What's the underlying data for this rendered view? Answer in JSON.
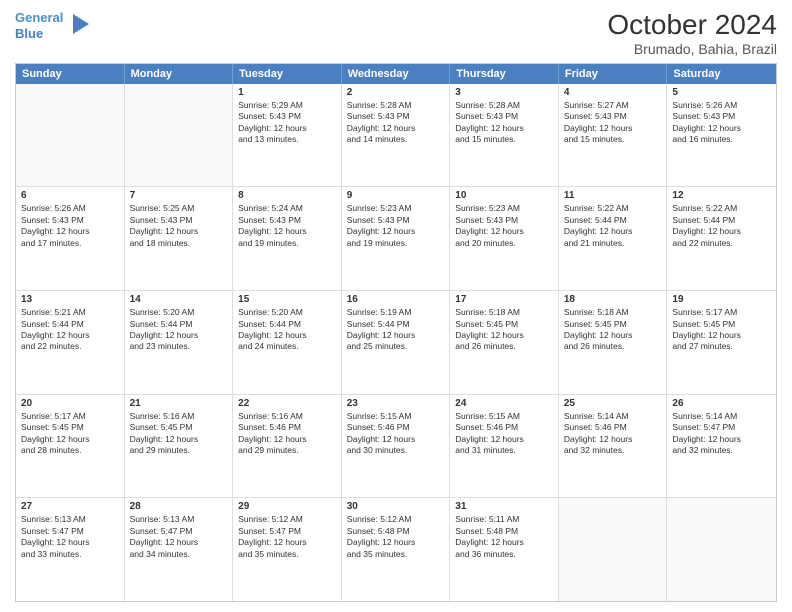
{
  "logo": {
    "line1": "General",
    "line2": "Blue",
    "icon": "▶"
  },
  "title": "October 2024",
  "subtitle": "Brumado, Bahia, Brazil",
  "header_days": [
    "Sunday",
    "Monday",
    "Tuesday",
    "Wednesday",
    "Thursday",
    "Friday",
    "Saturday"
  ],
  "weeks": [
    [
      {
        "day": "",
        "sunrise": "",
        "sunset": "",
        "daylight": "",
        "empty": true
      },
      {
        "day": "",
        "sunrise": "",
        "sunset": "",
        "daylight": "",
        "empty": true
      },
      {
        "day": "1",
        "sunrise": "Sunrise: 5:29 AM",
        "sunset": "Sunset: 5:43 PM",
        "daylight": "Daylight: 12 hours and 13 minutes.",
        "empty": false
      },
      {
        "day": "2",
        "sunrise": "Sunrise: 5:28 AM",
        "sunset": "Sunset: 5:43 PM",
        "daylight": "Daylight: 12 hours and 14 minutes.",
        "empty": false
      },
      {
        "day": "3",
        "sunrise": "Sunrise: 5:28 AM",
        "sunset": "Sunset: 5:43 PM",
        "daylight": "Daylight: 12 hours and 15 minutes.",
        "empty": false
      },
      {
        "day": "4",
        "sunrise": "Sunrise: 5:27 AM",
        "sunset": "Sunset: 5:43 PM",
        "daylight": "Daylight: 12 hours and 15 minutes.",
        "empty": false
      },
      {
        "day": "5",
        "sunrise": "Sunrise: 5:26 AM",
        "sunset": "Sunset: 5:43 PM",
        "daylight": "Daylight: 12 hours and 16 minutes.",
        "empty": false
      }
    ],
    [
      {
        "day": "6",
        "sunrise": "Sunrise: 5:26 AM",
        "sunset": "Sunset: 5:43 PM",
        "daylight": "Daylight: 12 hours and 17 minutes.",
        "empty": false
      },
      {
        "day": "7",
        "sunrise": "Sunrise: 5:25 AM",
        "sunset": "Sunset: 5:43 PM",
        "daylight": "Daylight: 12 hours and 18 minutes.",
        "empty": false
      },
      {
        "day": "8",
        "sunrise": "Sunrise: 5:24 AM",
        "sunset": "Sunset: 5:43 PM",
        "daylight": "Daylight: 12 hours and 19 minutes.",
        "empty": false
      },
      {
        "day": "9",
        "sunrise": "Sunrise: 5:23 AM",
        "sunset": "Sunset: 5:43 PM",
        "daylight": "Daylight: 12 hours and 19 minutes.",
        "empty": false
      },
      {
        "day": "10",
        "sunrise": "Sunrise: 5:23 AM",
        "sunset": "Sunset: 5:43 PM",
        "daylight": "Daylight: 12 hours and 20 minutes.",
        "empty": false
      },
      {
        "day": "11",
        "sunrise": "Sunrise: 5:22 AM",
        "sunset": "Sunset: 5:44 PM",
        "daylight": "Daylight: 12 hours and 21 minutes.",
        "empty": false
      },
      {
        "day": "12",
        "sunrise": "Sunrise: 5:22 AM",
        "sunset": "Sunset: 5:44 PM",
        "daylight": "Daylight: 12 hours and 22 minutes.",
        "empty": false
      }
    ],
    [
      {
        "day": "13",
        "sunrise": "Sunrise: 5:21 AM",
        "sunset": "Sunset: 5:44 PM",
        "daylight": "Daylight: 12 hours and 22 minutes.",
        "empty": false
      },
      {
        "day": "14",
        "sunrise": "Sunrise: 5:20 AM",
        "sunset": "Sunset: 5:44 PM",
        "daylight": "Daylight: 12 hours and 23 minutes.",
        "empty": false
      },
      {
        "day": "15",
        "sunrise": "Sunrise: 5:20 AM",
        "sunset": "Sunset: 5:44 PM",
        "daylight": "Daylight: 12 hours and 24 minutes.",
        "empty": false
      },
      {
        "day": "16",
        "sunrise": "Sunrise: 5:19 AM",
        "sunset": "Sunset: 5:44 PM",
        "daylight": "Daylight: 12 hours and 25 minutes.",
        "empty": false
      },
      {
        "day": "17",
        "sunrise": "Sunrise: 5:18 AM",
        "sunset": "Sunset: 5:45 PM",
        "daylight": "Daylight: 12 hours and 26 minutes.",
        "empty": false
      },
      {
        "day": "18",
        "sunrise": "Sunrise: 5:18 AM",
        "sunset": "Sunset: 5:45 PM",
        "daylight": "Daylight: 12 hours and 26 minutes.",
        "empty": false
      },
      {
        "day": "19",
        "sunrise": "Sunrise: 5:17 AM",
        "sunset": "Sunset: 5:45 PM",
        "daylight": "Daylight: 12 hours and 27 minutes.",
        "empty": false
      }
    ],
    [
      {
        "day": "20",
        "sunrise": "Sunrise: 5:17 AM",
        "sunset": "Sunset: 5:45 PM",
        "daylight": "Daylight: 12 hours and 28 minutes.",
        "empty": false
      },
      {
        "day": "21",
        "sunrise": "Sunrise: 5:16 AM",
        "sunset": "Sunset: 5:45 PM",
        "daylight": "Daylight: 12 hours and 29 minutes.",
        "empty": false
      },
      {
        "day": "22",
        "sunrise": "Sunrise: 5:16 AM",
        "sunset": "Sunset: 5:46 PM",
        "daylight": "Daylight: 12 hours and 29 minutes.",
        "empty": false
      },
      {
        "day": "23",
        "sunrise": "Sunrise: 5:15 AM",
        "sunset": "Sunset: 5:46 PM",
        "daylight": "Daylight: 12 hours and 30 minutes.",
        "empty": false
      },
      {
        "day": "24",
        "sunrise": "Sunrise: 5:15 AM",
        "sunset": "Sunset: 5:46 PM",
        "daylight": "Daylight: 12 hours and 31 minutes.",
        "empty": false
      },
      {
        "day": "25",
        "sunrise": "Sunrise: 5:14 AM",
        "sunset": "Sunset: 5:46 PM",
        "daylight": "Daylight: 12 hours and 32 minutes.",
        "empty": false
      },
      {
        "day": "26",
        "sunrise": "Sunrise: 5:14 AM",
        "sunset": "Sunset: 5:47 PM",
        "daylight": "Daylight: 12 hours and 32 minutes.",
        "empty": false
      }
    ],
    [
      {
        "day": "27",
        "sunrise": "Sunrise: 5:13 AM",
        "sunset": "Sunset: 5:47 PM",
        "daylight": "Daylight: 12 hours and 33 minutes.",
        "empty": false
      },
      {
        "day": "28",
        "sunrise": "Sunrise: 5:13 AM",
        "sunset": "Sunset: 5:47 PM",
        "daylight": "Daylight: 12 hours and 34 minutes.",
        "empty": false
      },
      {
        "day": "29",
        "sunrise": "Sunrise: 5:12 AM",
        "sunset": "Sunset: 5:47 PM",
        "daylight": "Daylight: 12 hours and 35 minutes.",
        "empty": false
      },
      {
        "day": "30",
        "sunrise": "Sunrise: 5:12 AM",
        "sunset": "Sunset: 5:48 PM",
        "daylight": "Daylight: 12 hours and 35 minutes.",
        "empty": false
      },
      {
        "day": "31",
        "sunrise": "Sunrise: 5:11 AM",
        "sunset": "Sunset: 5:48 PM",
        "daylight": "Daylight: 12 hours and 36 minutes.",
        "empty": false
      },
      {
        "day": "",
        "sunrise": "",
        "sunset": "",
        "daylight": "",
        "empty": true
      },
      {
        "day": "",
        "sunrise": "",
        "sunset": "",
        "daylight": "",
        "empty": true
      }
    ]
  ]
}
